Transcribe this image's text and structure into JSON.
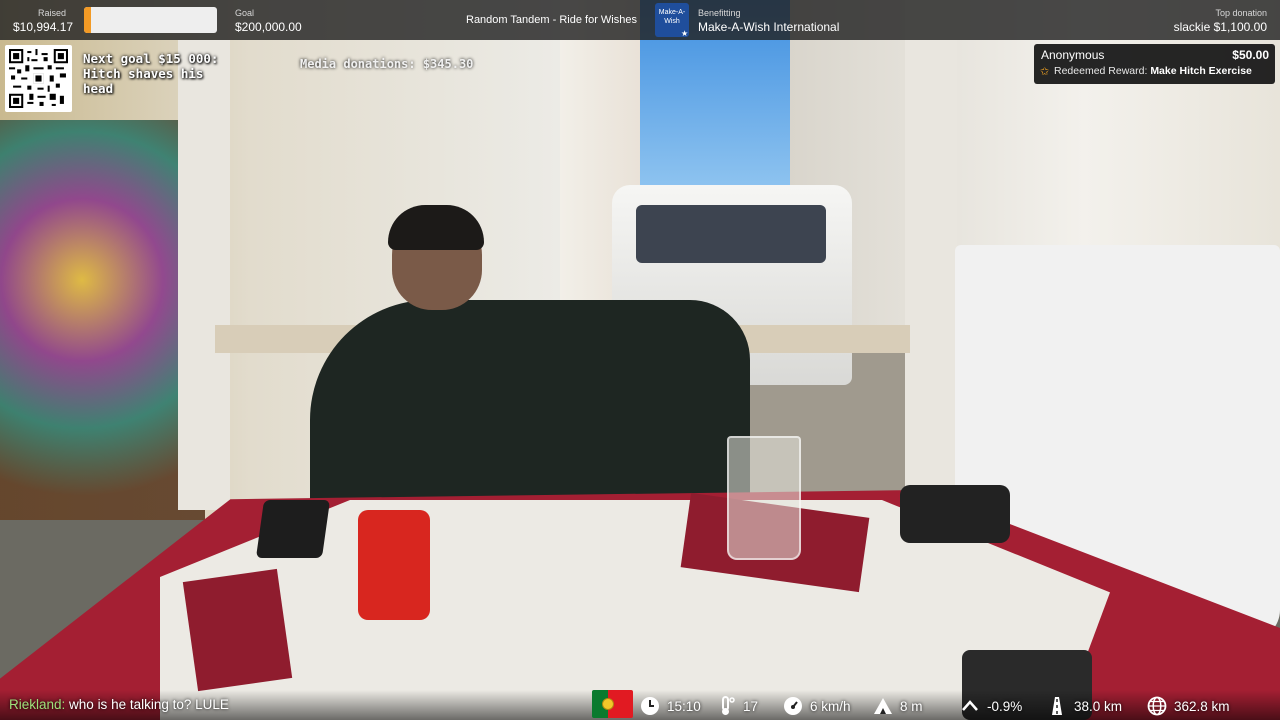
{
  "topbar": {
    "raised_label": "Raised",
    "raised_value": "$10,994.17",
    "progress_fraction": 0.055,
    "goal_label": "Goal",
    "goal_value": "$200,000.00",
    "event_title": "Random Tandem - Ride for Wishes",
    "benefitting_label": "Benefitting",
    "benefitting_value": "Make-A-Wish International",
    "logo_text": "Make-A-Wish",
    "top_donation_label": "Top donation",
    "top_donation_value": "slackie $1,100.00"
  },
  "overlay": {
    "next_goal": "Next goal $15 000: Hitch shaves his head",
    "media_donations": "Media donations: $345.30",
    "qr_icon": "qr-code-icon"
  },
  "reward": {
    "user": "Anonymous",
    "amount": "$50.00",
    "prefix": "Redeemed Reward:",
    "name": "Make Hitch Exercise",
    "icon": "star-icon"
  },
  "chat": {
    "user": "Riekland:",
    "message": "who is he talking to? LULE"
  },
  "telemetry": {
    "flag": "portugal-flag-icon",
    "time": "15:10",
    "temperature": "17",
    "speed": "6 km/h",
    "altitude": "8 m",
    "grade": "-0.9%",
    "distance_today": "38.0 km",
    "distance_total": "362.8 km"
  },
  "colors": {
    "progress_fill": "#f29a25",
    "chat_user": "#9fe07a",
    "reward_star": "#f5a623",
    "logo_blue": "#1f4e9c"
  }
}
